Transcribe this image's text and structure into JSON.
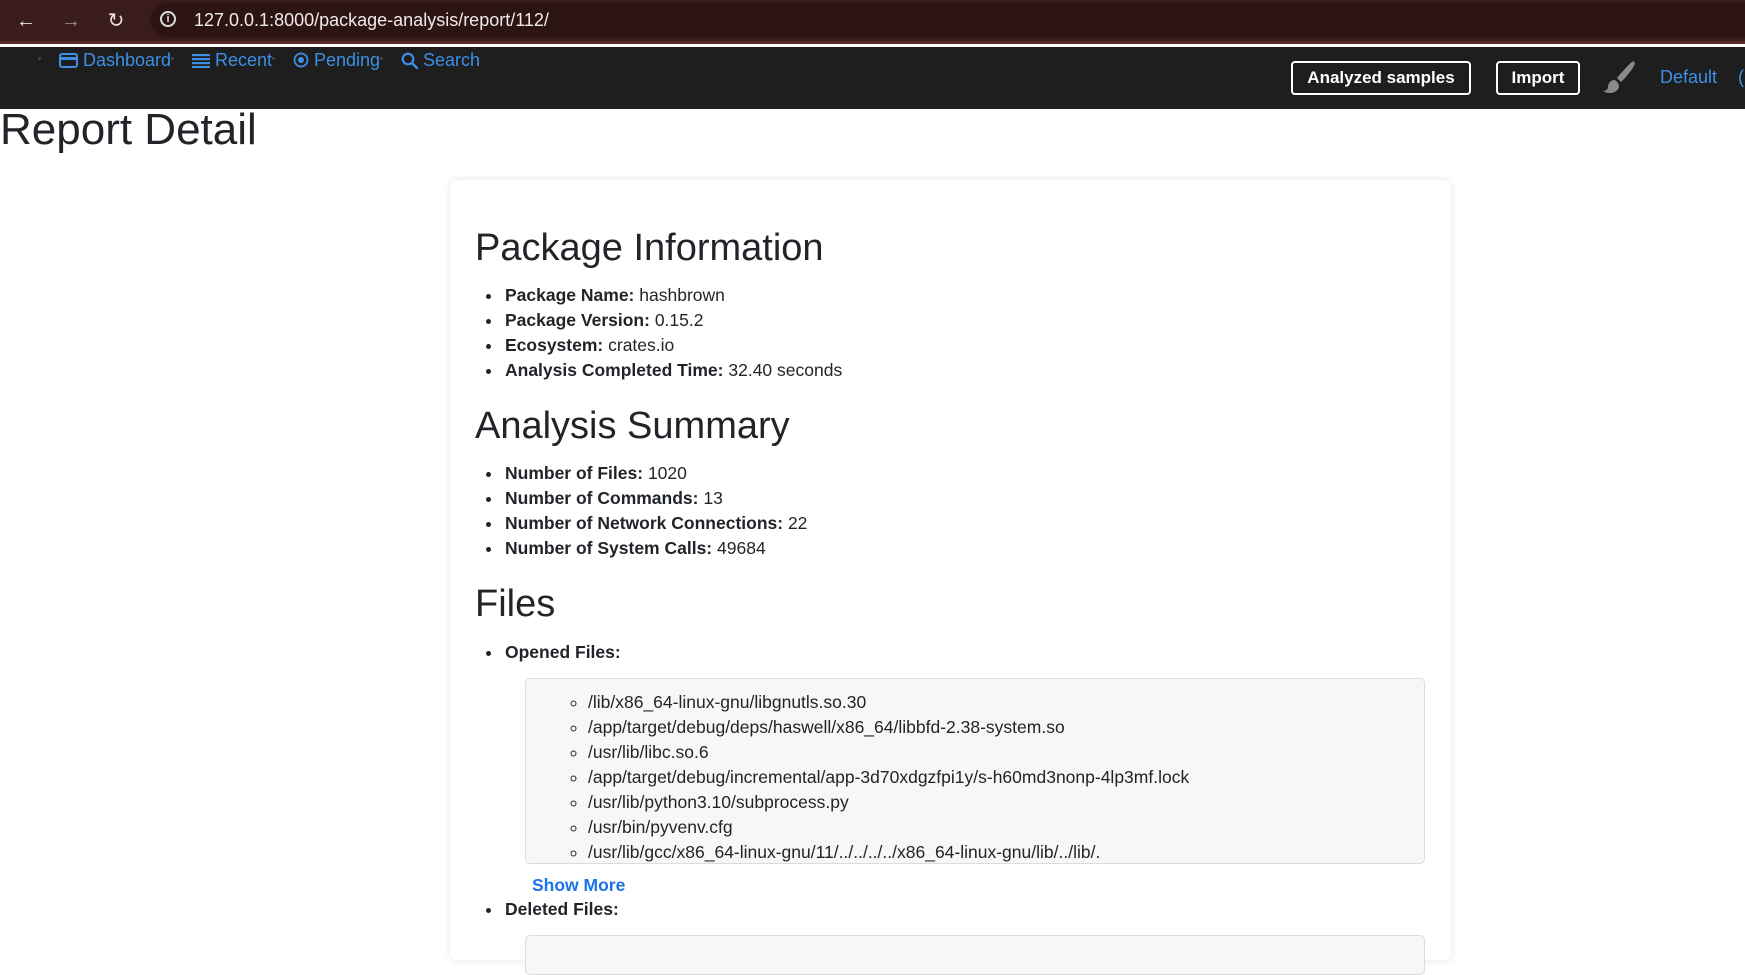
{
  "browser": {
    "url": "127.0.0.1:8000/package-analysis/report/112/"
  },
  "nav": {
    "links": [
      {
        "label": "Dashboard",
        "icon": "credit-card-icon"
      },
      {
        "label": "Recent",
        "icon": "list-icon"
      },
      {
        "label": "Pending",
        "icon": "record-icon"
      },
      {
        "label": "Search",
        "icon": "search-icon"
      }
    ],
    "analyzed_label": "Analyzed samples",
    "import_label": "Import",
    "theme_label": "Default"
  },
  "page": {
    "title": "Report Detail"
  },
  "package_info": {
    "heading": "Package Information",
    "items": [
      {
        "label": "Package Name:",
        "value": "hashbrown"
      },
      {
        "label": "Package Version:",
        "value": "0.15.2"
      },
      {
        "label": "Ecosystem:",
        "value": "crates.io"
      },
      {
        "label": "Analysis Completed Time:",
        "value": "32.40 seconds"
      }
    ]
  },
  "summary": {
    "heading": "Analysis Summary",
    "items": [
      {
        "label": "Number of Files:",
        "value": "1020"
      },
      {
        "label": "Number of Commands:",
        "value": "13"
      },
      {
        "label": "Number of Network Connections:",
        "value": "22"
      },
      {
        "label": "Number of System Calls:",
        "value": "49684"
      }
    ]
  },
  "files": {
    "heading": "Files",
    "opened_label": "Opened Files:",
    "opened": [
      "/lib/x86_64-linux-gnu/libgnutls.so.30",
      "/app/target/debug/deps/haswell/x86_64/libbfd-2.38-system.so",
      "/usr/lib/libc.so.6",
      "/app/target/debug/incremental/app-3d70xdgzfpi1y/s-h60md3nonp-4lp3mf.lock",
      "/usr/lib/python3.10/subprocess.py",
      "/usr/bin/pyvenv.cfg",
      "/usr/lib/gcc/x86_64-linux-gnu/11/../../../../x86_64-linux-gnu/lib/../lib/."
    ],
    "show_more_label": "Show More",
    "deleted_label": "Deleted Files:"
  }
}
